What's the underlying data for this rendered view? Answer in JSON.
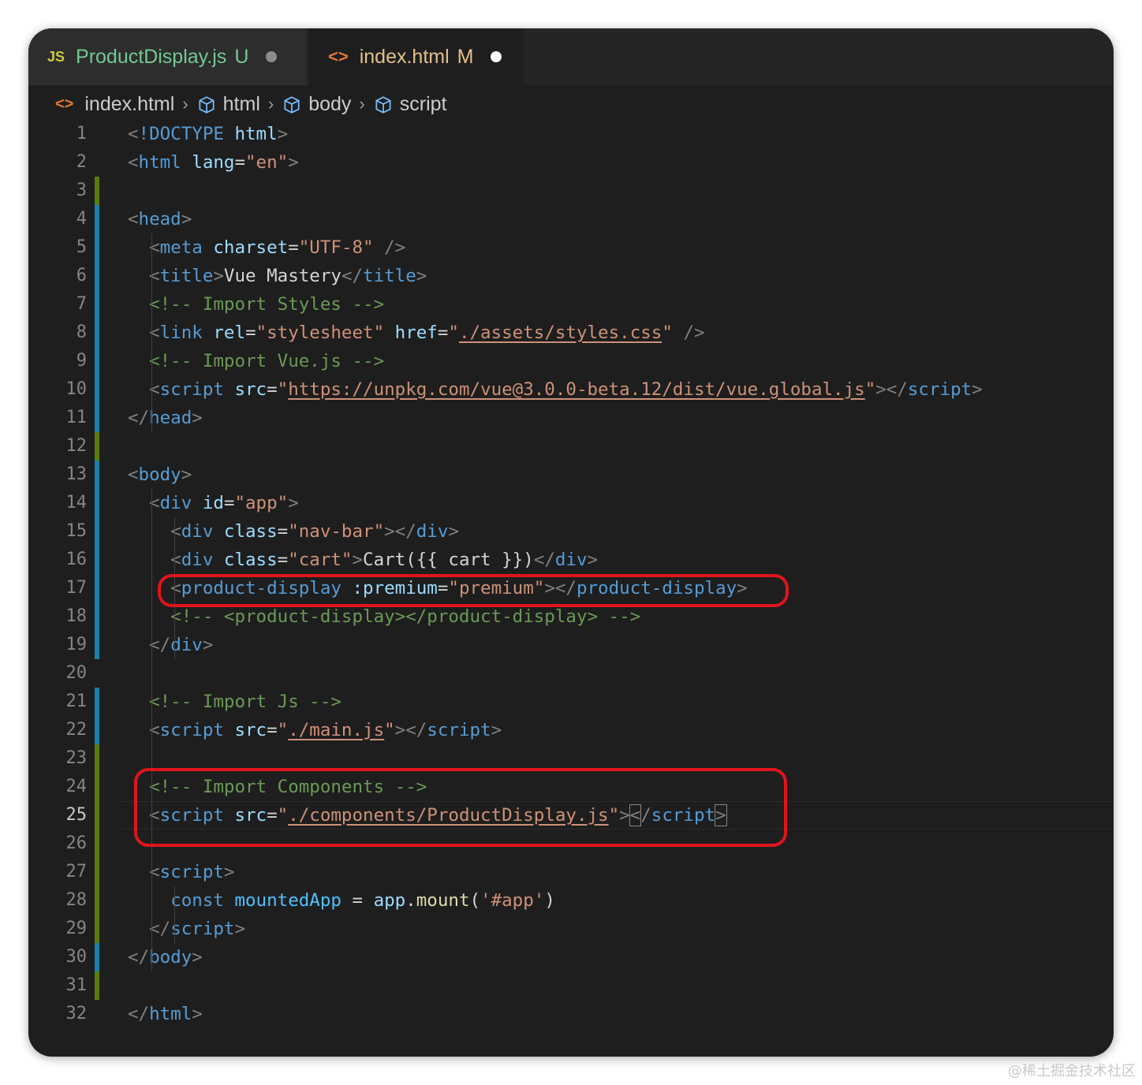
{
  "tabs": [
    {
      "icon": "JS",
      "name": "ProductDisplay.js",
      "status": "U",
      "active": false
    },
    {
      "icon": "<>",
      "name": "index.html",
      "status": "M",
      "active": true
    }
  ],
  "breadcrumb": {
    "file": "index.html",
    "items": [
      "html",
      "body",
      "script"
    ]
  },
  "lines": [
    {
      "n": "1",
      "html": "<span class=\"t-br\">&lt;</span><span class=\"t-doc\">!DOCTYPE</span> <span class=\"t-attr\">html</span><span class=\"t-br\">&gt;</span>"
    },
    {
      "n": "2",
      "html": "<span class=\"t-br\">&lt;</span><span class=\"t-tag\">html</span> <span class=\"t-attr\">lang</span><span class=\"t-txt\">=</span><span class=\"t-str\">\"en\"</span><span class=\"t-br\">&gt;</span>"
    },
    {
      "n": "3",
      "html": ""
    },
    {
      "n": "4",
      "html": "<span class=\"t-br\">&lt;</span><span class=\"t-tag\">head</span><span class=\"t-br\">&gt;</span>"
    },
    {
      "n": "5",
      "html": "  <span class=\"t-br\">&lt;</span><span class=\"t-tag\">meta</span> <span class=\"t-attr\">charset</span><span class=\"t-txt\">=</span><span class=\"t-str\">\"UTF-8\"</span> <span class=\"t-br\">/&gt;</span>"
    },
    {
      "n": "6",
      "html": "  <span class=\"t-br\">&lt;</span><span class=\"t-tag\">title</span><span class=\"t-br\">&gt;</span><span class=\"t-txt\">Vue Mastery</span><span class=\"t-br\">&lt;/</span><span class=\"t-tag\">title</span><span class=\"t-br\">&gt;</span>"
    },
    {
      "n": "7",
      "html": "  <span class=\"t-com\">&lt;!-- Import Styles --&gt;</span>"
    },
    {
      "n": "8",
      "html": "  <span class=\"t-br\">&lt;</span><span class=\"t-tag\">link</span> <span class=\"t-attr\">rel</span><span class=\"t-txt\">=</span><span class=\"t-str\">\"stylesheet\"</span> <span class=\"t-attr\">href</span><span class=\"t-txt\">=</span><span class=\"t-str\">\"</span><span class=\"t-url\">./assets/styles.css</span><span class=\"t-str\">\"</span> <span class=\"t-br\">/&gt;</span>"
    },
    {
      "n": "9",
      "html": "  <span class=\"t-com\">&lt;!-- Import Vue.js --&gt;</span>"
    },
    {
      "n": "10",
      "html": "  <span class=\"t-br\">&lt;</span><span class=\"t-tag\">script</span> <span class=\"t-attr\">src</span><span class=\"t-txt\">=</span><span class=\"t-str\">\"</span><span class=\"t-url\">https://unpkg.com/vue@3.0.0-beta.12/dist/vue.global.js</span><span class=\"t-str\">\"</span><span class=\"t-br\">&gt;&lt;/</span><span class=\"t-tag\">script</span><span class=\"t-br\">&gt;</span>"
    },
    {
      "n": "11",
      "html": "<span class=\"t-br\">&lt;/</span><span class=\"t-tag\">head</span><span class=\"t-br\">&gt;</span>"
    },
    {
      "n": "12",
      "html": ""
    },
    {
      "n": "13",
      "html": "<span class=\"t-br\">&lt;</span><span class=\"t-tag\">body</span><span class=\"t-br\">&gt;</span>"
    },
    {
      "n": "14",
      "html": "  <span class=\"t-br\">&lt;</span><span class=\"t-tag\">div</span> <span class=\"t-attr\">id</span><span class=\"t-txt\">=</span><span class=\"t-str\">\"app\"</span><span class=\"t-br\">&gt;</span>"
    },
    {
      "n": "15",
      "html": "    <span class=\"t-br\">&lt;</span><span class=\"t-tag\">div</span> <span class=\"t-attr\">class</span><span class=\"t-txt\">=</span><span class=\"t-str\">\"nav-bar\"</span><span class=\"t-br\">&gt;&lt;/</span><span class=\"t-tag\">div</span><span class=\"t-br\">&gt;</span>"
    },
    {
      "n": "16",
      "html": "    <span class=\"t-br\">&lt;</span><span class=\"t-tag\">div</span> <span class=\"t-attr\">class</span><span class=\"t-txt\">=</span><span class=\"t-str\">\"cart\"</span><span class=\"t-br\">&gt;</span><span class=\"t-txt\">Cart({{ cart }})</span><span class=\"t-br\">&lt;/</span><span class=\"t-tag\">div</span><span class=\"t-br\">&gt;</span>"
    },
    {
      "n": "17",
      "html": "    <span class=\"t-br\">&lt;</span><span class=\"t-tag\">product-display</span> <span class=\"t-attr\">:premium</span><span class=\"t-txt\">=</span><span class=\"t-str\">\"premium\"</span><span class=\"t-br\">&gt;&lt;/</span><span class=\"t-tag\">product-display</span><span class=\"t-br\">&gt;</span>"
    },
    {
      "n": "18",
      "html": "    <span class=\"t-com\">&lt;!-- &lt;product-display&gt;&lt;/product-display&gt; --&gt;</span>"
    },
    {
      "n": "19",
      "html": "  <span class=\"t-br\">&lt;/</span><span class=\"t-tag\">div</span><span class=\"t-br\">&gt;</span>"
    },
    {
      "n": "20",
      "html": ""
    },
    {
      "n": "21",
      "html": "  <span class=\"t-com\">&lt;!-- Import Js --&gt;</span>"
    },
    {
      "n": "22",
      "html": "  <span class=\"t-br\">&lt;</span><span class=\"t-tag\">script</span> <span class=\"t-attr\">src</span><span class=\"t-txt\">=</span><span class=\"t-str\">\"</span><span class=\"t-url\">./main.js</span><span class=\"t-str\">\"</span><span class=\"t-br\">&gt;&lt;/</span><span class=\"t-tag\">script</span><span class=\"t-br\">&gt;</span>"
    },
    {
      "n": "23",
      "html": ""
    },
    {
      "n": "24",
      "html": "  <span class=\"t-com\">&lt;!-- Import Components --&gt;</span>"
    },
    {
      "n": "25",
      "html": "  <span class=\"t-br\">&lt;</span><span class=\"t-tag\">script</span> <span class=\"t-attr\">src</span><span class=\"t-txt\">=</span><span class=\"t-str\">\"</span><span class=\"t-url\">./components/ProductDisplay.js</span><span class=\"t-str\">\"</span><span class=\"t-br\">&gt;</span><span class=\"t-br bracket-box\">&lt;</span><span class=\"t-br\">/</span><span class=\"t-tag\">script</span><span class=\"t-br bracket-box\">&gt;</span>"
    },
    {
      "n": "26",
      "html": ""
    },
    {
      "n": "27",
      "html": "  <span class=\"t-br\">&lt;</span><span class=\"t-tag\">script</span><span class=\"t-br\">&gt;</span>"
    },
    {
      "n": "28",
      "html": "    <span class=\"t-kw\">const</span> <span class=\"t-var\">mountedApp</span> <span class=\"t-txt\">=</span> <span class=\"t-attr\">app</span><span class=\"t-txt\">.</span><span class=\"t-fn\">mount</span><span class=\"t-txt\">(</span><span class=\"t-str\">'#app'</span><span class=\"t-txt\">)</span>"
    },
    {
      "n": "29",
      "html": "  <span class=\"t-br\">&lt;/</span><span class=\"t-tag\">script</span><span class=\"t-br\">&gt;</span>"
    },
    {
      "n": "30",
      "html": "<span class=\"t-br\">&lt;/</span><span class=\"t-tag\">body</span><span class=\"t-br\">&gt;</span>"
    },
    {
      "n": "31",
      "html": ""
    },
    {
      "n": "32",
      "html": "<span class=\"t-br\">&lt;/</span><span class=\"t-tag\">html</span><span class=\"t-br\">&gt;</span>"
    }
  ],
  "active_line": "25",
  "gutter": {
    "3": "#587c0c",
    "4": "#1b81a8",
    "5": "#1b81a8",
    "6": "#1b81a8",
    "7": "#1b81a8",
    "8": "#1b81a8",
    "9": "#1b81a8",
    "10": "#1b81a8",
    "11": "#1b81a8",
    "12": "#587c0c",
    "13": "#1b81a8",
    "14": "#1b81a8",
    "15": "#1b81a8",
    "16": "#1b81a8",
    "17": "#1b81a8",
    "18": "#1b81a8",
    "19": "#1b81a8",
    "21": "#1b81a8",
    "22": "#1b81a8",
    "23": "#587c0c",
    "24": "#587c0c",
    "25": "#587c0c",
    "26": "#587c0c",
    "27": "#587c0c",
    "28": "#587c0c",
    "29": "#587c0c",
    "30": "#1b81a8",
    "31": "#587c0c"
  },
  "colors": {
    "highlight_box": "#e0141c",
    "editor_bg": "#1e1e1e"
  },
  "watermark": "@稀土掘金技术社区"
}
